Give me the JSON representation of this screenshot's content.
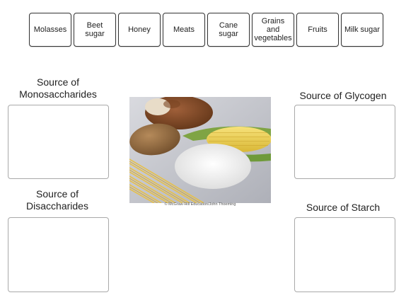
{
  "chips": [
    {
      "id": "molasses",
      "label": "Molasses"
    },
    {
      "id": "beet-sugar",
      "label": "Beet sugar"
    },
    {
      "id": "honey",
      "label": "Honey"
    },
    {
      "id": "meats",
      "label": "Meats"
    },
    {
      "id": "cane-sugar",
      "label": "Cane sugar"
    },
    {
      "id": "grains-and-vegetables",
      "label": "Grains and vegetables"
    },
    {
      "id": "fruits",
      "label": "Fruits"
    },
    {
      "id": "milk-sugar",
      "label": "Milk sugar"
    }
  ],
  "zones": {
    "monosaccharides": {
      "label": "Source of Monosaccharides"
    },
    "disaccharides": {
      "label": "Source of Disaccharides"
    },
    "glycogen": {
      "label": "Source of Glycogen"
    },
    "starch": {
      "label": "Source of Starch"
    }
  },
  "photo": {
    "credit": "© McGraw-Hill Education/John Thoeming"
  }
}
